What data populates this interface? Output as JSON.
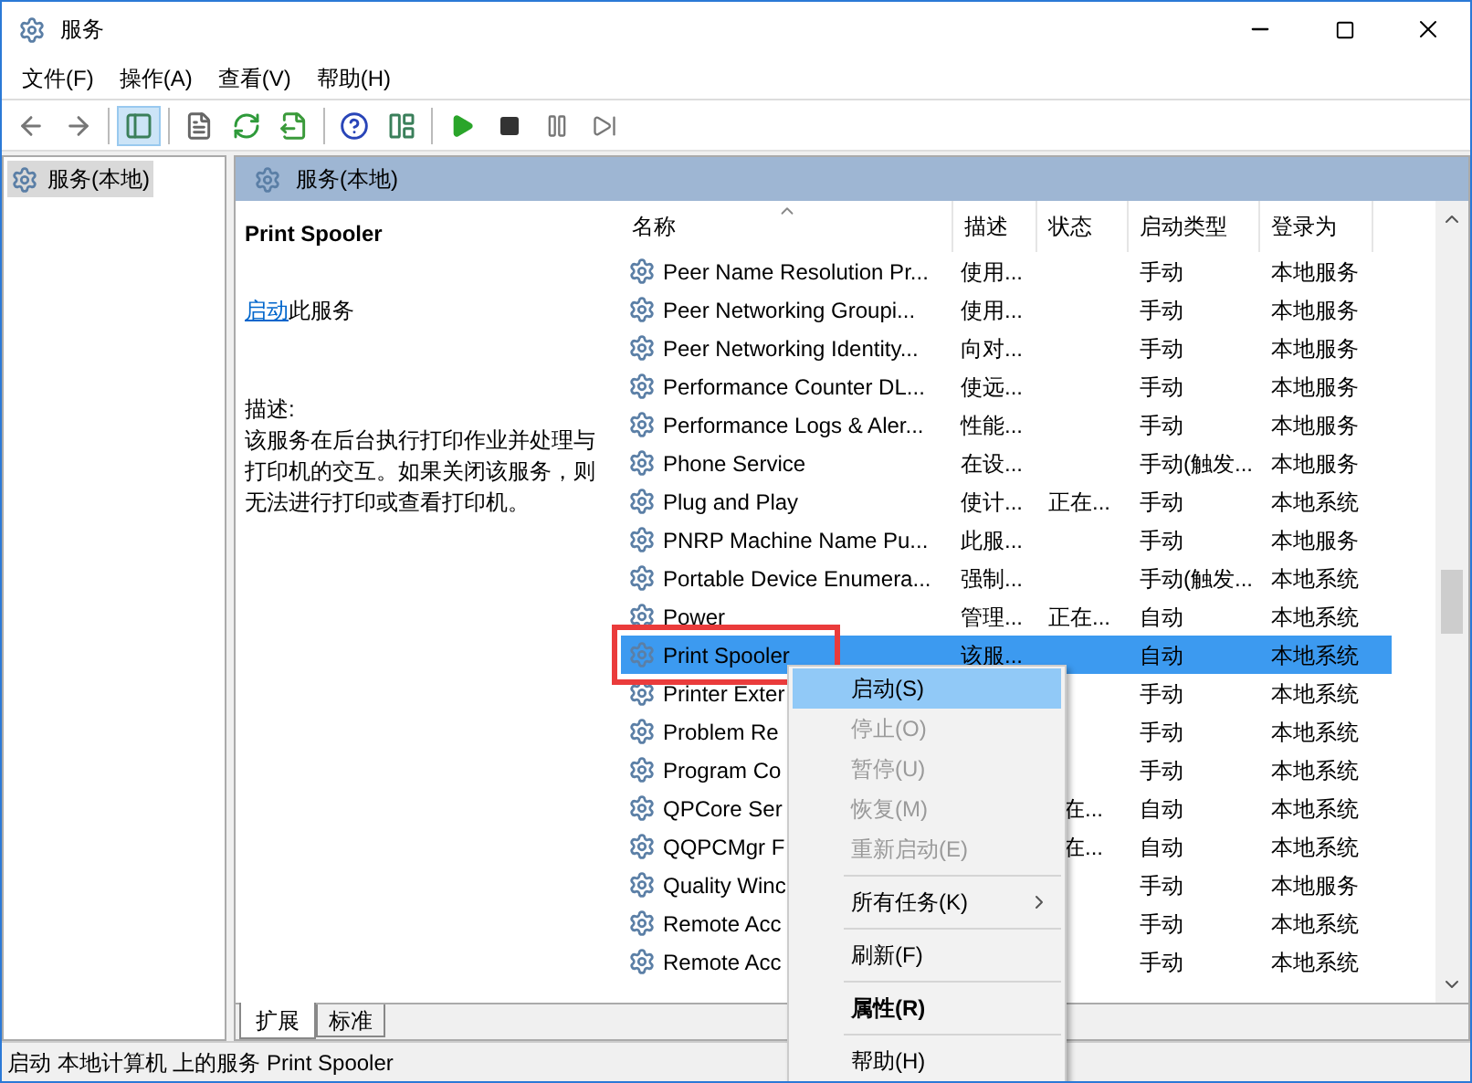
{
  "window": {
    "title": "服务"
  },
  "menu_bar": [
    "文件(F)",
    "操作(A)",
    "查看(V)",
    "帮助(H)"
  ],
  "toolbar": [
    {
      "kind": "back",
      "selected": false
    },
    {
      "kind": "forward",
      "selected": false
    },
    {
      "kind": "sep"
    },
    {
      "kind": "console-tree",
      "selected": true
    },
    {
      "kind": "sep"
    },
    {
      "kind": "properties",
      "selected": false
    },
    {
      "kind": "refresh",
      "selected": false
    },
    {
      "kind": "export",
      "selected": false
    },
    {
      "kind": "sep"
    },
    {
      "kind": "help",
      "selected": false
    },
    {
      "kind": "view",
      "selected": false
    },
    {
      "kind": "sep"
    },
    {
      "kind": "start",
      "selected": false
    },
    {
      "kind": "stop",
      "selected": false
    },
    {
      "kind": "pause",
      "selected": false
    },
    {
      "kind": "resume",
      "selected": false
    }
  ],
  "tree": [
    {
      "label": "服务(本地)",
      "selected": true
    }
  ],
  "pane_title": "服务(本地)",
  "details": {
    "title": "Print Spooler",
    "action_link": "启动",
    "action_text": "此服务",
    "description_label": "描述:",
    "description": "该服务在后台执行打印作业并处理与打印机的交互。如果关闭该服务，则无法进行打印或查看打印机。"
  },
  "table": {
    "columns": [
      {
        "label": "名称",
        "sorted": true
      },
      {
        "label": "描述",
        "sorted": false
      },
      {
        "label": "状态",
        "sorted": false
      },
      {
        "label": "启动类型",
        "sorted": false
      },
      {
        "label": "登录为",
        "sorted": false
      }
    ],
    "rows": [
      {
        "name": "Peer Name Resolution Pr...",
        "description": "使用...",
        "status": "",
        "startup": "手动",
        "logon": "本地服务",
        "selected": false,
        "covered": false,
        "annotated": false
      },
      {
        "name": "Peer Networking Groupi...",
        "description": "使用...",
        "status": "",
        "startup": "手动",
        "logon": "本地服务",
        "selected": false,
        "covered": false,
        "annotated": false
      },
      {
        "name": "Peer Networking Identity...",
        "description": "向对...",
        "status": "",
        "startup": "手动",
        "logon": "本地服务",
        "selected": false,
        "covered": false,
        "annotated": false
      },
      {
        "name": "Performance Counter DL...",
        "description": "使远...",
        "status": "",
        "startup": "手动",
        "logon": "本地服务",
        "selected": false,
        "covered": false,
        "annotated": false
      },
      {
        "name": "Performance Logs & Aler...",
        "description": "性能...",
        "status": "",
        "startup": "手动",
        "logon": "本地服务",
        "selected": false,
        "covered": false,
        "annotated": false
      },
      {
        "name": "Phone Service",
        "description": "在设...",
        "status": "",
        "startup": "手动(触发...",
        "logon": "本地服务",
        "selected": false,
        "covered": false,
        "annotated": false
      },
      {
        "name": "Plug and Play",
        "description": "使计...",
        "status": "正在...",
        "startup": "手动",
        "logon": "本地系统",
        "selected": false,
        "covered": false,
        "annotated": false
      },
      {
        "name": "PNRP Machine Name Pu...",
        "description": "此服...",
        "status": "",
        "startup": "手动",
        "logon": "本地服务",
        "selected": false,
        "covered": false,
        "annotated": false
      },
      {
        "name": "Portable Device Enumera...",
        "description": "强制...",
        "status": "",
        "startup": "手动(触发...",
        "logon": "本地系统",
        "selected": false,
        "covered": false,
        "annotated": false
      },
      {
        "name": "Power",
        "description": "管理...",
        "status": "正在...",
        "startup": "自动",
        "logon": "本地系统",
        "selected": false,
        "covered": false,
        "annotated": false
      },
      {
        "name": "Print Spooler",
        "description": "该服...",
        "status": "",
        "startup": "自动",
        "logon": "本地系统",
        "selected": true,
        "covered": false,
        "annotated": true
      },
      {
        "name": "Printer Exter",
        "description": "",
        "status": "",
        "startup": "手动",
        "logon": "本地系统",
        "selected": false,
        "covered": true,
        "annotated": false
      },
      {
        "name": "Problem Re",
        "description": "",
        "status": "",
        "startup": "手动",
        "logon": "本地系统",
        "selected": false,
        "covered": true,
        "annotated": false
      },
      {
        "name": "Program Co",
        "description": "",
        "status": "",
        "startup": "手动",
        "logon": "本地系统",
        "selected": false,
        "covered": true,
        "annotated": false
      },
      {
        "name": "QPCore Ser",
        "description": "",
        "status": "在...",
        "startup": "自动",
        "logon": "本地系统",
        "selected": false,
        "covered": true,
        "annotated": false
      },
      {
        "name": "QQPCMgr F",
        "description": "",
        "status": "在...",
        "startup": "自动",
        "logon": "本地系统",
        "selected": false,
        "covered": true,
        "annotated": false
      },
      {
        "name": "Quality Winc",
        "description": "",
        "status": "",
        "startup": "手动",
        "logon": "本地服务",
        "selected": false,
        "covered": true,
        "annotated": false
      },
      {
        "name": "Remote Acc",
        "description": "",
        "status": "",
        "startup": "手动",
        "logon": "本地系统",
        "selected": false,
        "covered": true,
        "annotated": false
      },
      {
        "name": "Remote Acc",
        "description": "",
        "status": "",
        "startup": "手动",
        "logon": "本地系统",
        "selected": false,
        "covered": true,
        "annotated": false
      }
    ]
  },
  "context_menu": [
    {
      "kind": "item",
      "label": "启动(S)",
      "selected": true,
      "disabled": false,
      "bold": false,
      "submenu": false
    },
    {
      "kind": "item",
      "label": "停止(O)",
      "selected": false,
      "disabled": true,
      "bold": false,
      "submenu": false
    },
    {
      "kind": "item",
      "label": "暂停(U)",
      "selected": false,
      "disabled": true,
      "bold": false,
      "submenu": false
    },
    {
      "kind": "item",
      "label": "恢复(M)",
      "selected": false,
      "disabled": true,
      "bold": false,
      "submenu": false
    },
    {
      "kind": "item",
      "label": "重新启动(E)",
      "selected": false,
      "disabled": true,
      "bold": false,
      "submenu": false
    },
    {
      "kind": "separator"
    },
    {
      "kind": "item",
      "label": "所有任务(K)",
      "selected": false,
      "disabled": false,
      "bold": false,
      "submenu": true
    },
    {
      "kind": "separator"
    },
    {
      "kind": "item",
      "label": "刷新(F)",
      "selected": false,
      "disabled": false,
      "bold": false,
      "submenu": false
    },
    {
      "kind": "separator"
    },
    {
      "kind": "item",
      "label": "属性(R)",
      "selected": false,
      "disabled": false,
      "bold": true,
      "submenu": false
    },
    {
      "kind": "separator"
    },
    {
      "kind": "item",
      "label": "帮助(H)",
      "selected": false,
      "disabled": false,
      "bold": false,
      "submenu": false
    }
  ],
  "view_tabs": [
    {
      "label": "扩展",
      "selected": true
    },
    {
      "label": "标准",
      "selected": false
    }
  ],
  "status_bar": "启动 本地计算机 上的服务 Print Spooler"
}
